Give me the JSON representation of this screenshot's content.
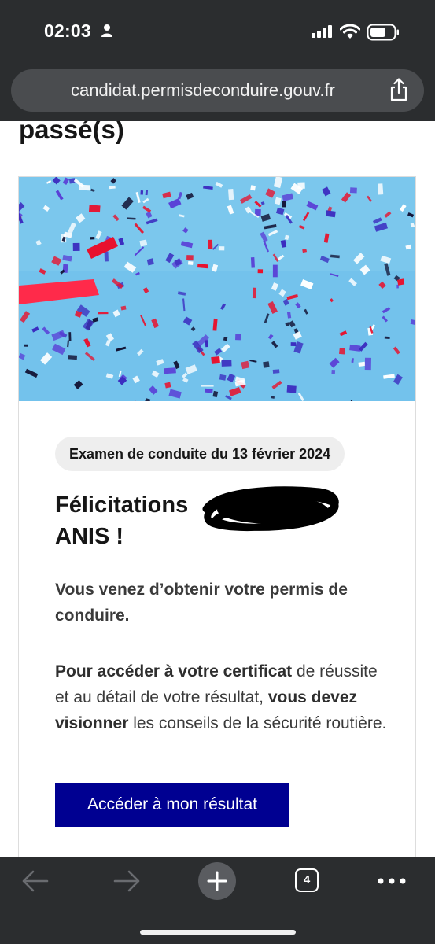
{
  "status_bar": {
    "time": "02:03"
  },
  "browser": {
    "url": "candidat.permisdeconduire.gouv.fr",
    "tab_count": "4"
  },
  "page": {
    "heading": "passé(s)",
    "card": {
      "badge": "Examen de conduite du 13 février 2024",
      "congrats_line1": "Félicitations",
      "congrats_line2": "ANIS !",
      "paragraph1": "Vous venez d’obtenir votre permis de conduire.",
      "paragraph2": {
        "part1_bold": "Pour accéder à votre certificat",
        "part2": " de réussite et au détail de votre résultat, ",
        "part3_bold": "vous devez visionner",
        "part4": " les conseils de la sécurité routière."
      },
      "button_label": "Accéder à mon résultat"
    }
  },
  "colors": {
    "primary_button": "#000091",
    "sky": "#6fc0ea",
    "confetti_red": "#e8112d",
    "confetti_blue": "#3b2bbf"
  },
  "icons": [
    "person-icon",
    "signal-icon",
    "wifi-icon",
    "battery-icon",
    "share-icon",
    "back-icon",
    "forward-icon",
    "plus-icon",
    "more-icon"
  ]
}
